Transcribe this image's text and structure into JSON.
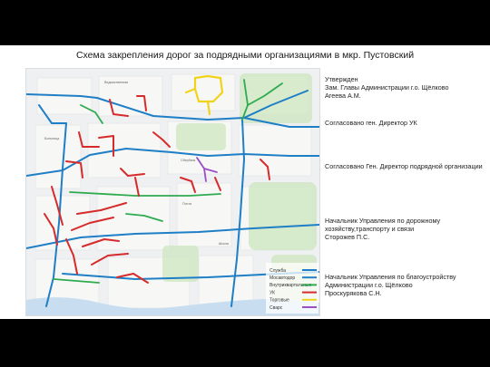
{
  "title": "Схема закрепления дорог за подрядными организациями в мкр. Пустовский",
  "approvals": [
    "Утвержден\nЗам. Главы Администрации г.о. Щёлково\nАгеева А.М.",
    "Согласовано ген. Директор УК",
    "Согласовано Ген. Директор подрядной организации",
    "Начальник Управления по дорожному хозяйству,транспорту и связи\nСторожев П.С.",
    "Начальник Управления по благоустройству Администрации г.о. Щёлково\nПроскурякова С.Н."
  ],
  "map": {
    "legend": [
      {
        "label": "Служба",
        "color": "#1f7fc6"
      },
      {
        "label": "Мосавтодор",
        "color": "#1f7fc6"
      },
      {
        "label": "Внутриквартальные",
        "color": "#2eaa4f"
      },
      {
        "label": "УК",
        "color": "#d62b2b"
      },
      {
        "label": "Торговые",
        "color": "#f2d31b"
      },
      {
        "label": "Сварс",
        "color": "#9a4fc2"
      }
    ],
    "place_labels": [
      "Ведомственная",
      "Больница",
      "Сбербанк",
      "Почта",
      "Школа"
    ],
    "colors": {
      "blue": "#1f7fc6",
      "green": "#2eaa4f",
      "red": "#d62b2b",
      "yellow": "#f2d31b",
      "purple": "#9a4fc2",
      "brown": "#6d3a1f"
    }
  }
}
